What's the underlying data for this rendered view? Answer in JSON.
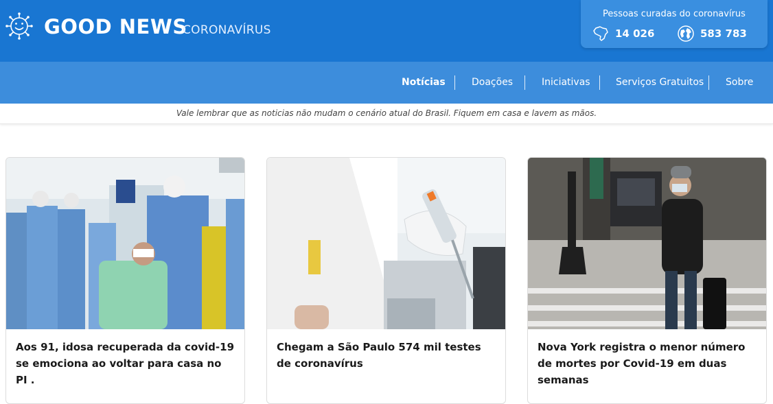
{
  "header": {
    "brand": "GOOD NEWS",
    "subtitle": "CORONAVÍRUS",
    "logo_icon": "virus-smile-icon"
  },
  "stats": {
    "title": "Pessoas curadas do coronavírus",
    "brazil": {
      "icon": "brazil-map-icon",
      "value": "14 026"
    },
    "world": {
      "icon": "globe-icon",
      "value": "583 783"
    }
  },
  "nav": {
    "items": [
      {
        "label": "Notícias",
        "active": true
      },
      {
        "label": "Doações"
      },
      {
        "label": "Iniciativas"
      },
      {
        "label": "Serviços Gratuitos"
      },
      {
        "label": "Sobre"
      }
    ]
  },
  "notice": "Vale lembrar que as noticias não mudam o cenário atual do Brasil. Fiquem em casa e lavem as mãos.",
  "cards": [
    {
      "title": "Aos 91, idosa recuperada da covid-19 se emociona ao voltar para casa no PI ."
    },
    {
      "title": "Chegam a São Paulo 574 mil testes de coronavírus"
    },
    {
      "title": "Nova York registra o menor número de mortes por Covid-19 em duas semanas"
    }
  ],
  "colors": {
    "header_bg": "#1976d2",
    "nav_bg": "#3d8ddc",
    "stats_bg": "#3a8fe0"
  }
}
